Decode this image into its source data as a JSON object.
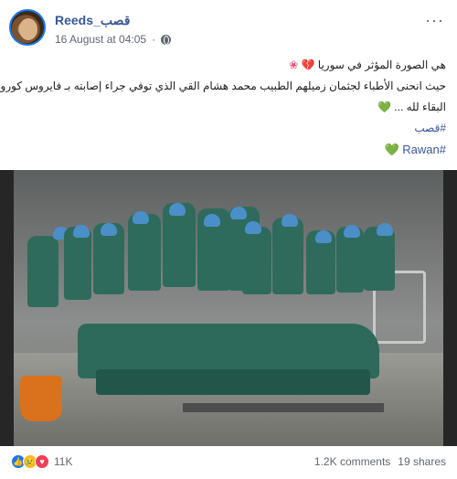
{
  "post": {
    "author": "Reeds_قصب",
    "date": "16 August at 04:05",
    "separator": "·",
    "more": "···",
    "line1": "هي الصورة المؤثر في سوريا",
    "line2": "حيث انحنى الأطباء لجثمان زميلهم الطبيب محمد هشام القي الذي توفي جراء إصابته بـ فايروس كورونا ..",
    "line3": "البقاء لله ...",
    "hashtag1": "#قصب",
    "hashtag2": "#Rawan",
    "emoji_heart": "💔",
    "emoji_flower": "❀",
    "emoji_green": "💚"
  },
  "stats": {
    "reactions": "11K",
    "comments": "1.2K comments",
    "shares": "19 shares"
  },
  "icons": {
    "like": "👍",
    "sad": "😢",
    "love": "♥"
  }
}
